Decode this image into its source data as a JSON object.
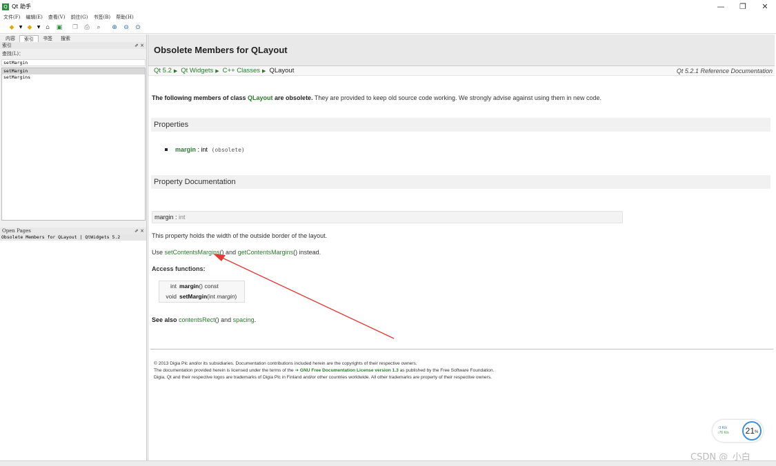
{
  "window": {
    "title": "Qt 助手",
    "icon": "qt-assistant-icon",
    "controls": [
      "—",
      "❐",
      "✕"
    ]
  },
  "menu": [
    "文件(F)",
    "编辑(E)",
    "查看(V)",
    "前往(G)",
    "书签(B)",
    "帮助(H)"
  ],
  "left_panel": {
    "tabs": [
      "内容",
      "索引",
      "书签",
      "搜索"
    ],
    "active_tab": "索引",
    "index_dock_title": "索引",
    "find_label": "查找(L)：",
    "search_value": "setMargin",
    "results": [
      "setMargin",
      "setMargins"
    ],
    "open_pages_title": "Open Pages",
    "open_pages": [
      "Obsolete Members for QLayout | QtWidgets 5.2"
    ]
  },
  "page": {
    "title": "Obsolete Members for QLayout",
    "breadcrumbs": [
      "Qt 5.2",
      "Qt Widgets",
      "C++ Classes"
    ],
    "breadcrumb_current": "QLayout",
    "ref_doc": "Qt 5.2.1 Reference Documentation",
    "intro": {
      "p1": "The following members of class ",
      "class_link": "QLayout",
      "p2": " are obsolete.",
      "p3": " They are provided to keep old source code working. We strongly advise against using them in new code."
    },
    "properties_heading": "Properties",
    "property_item": {
      "name": "margin",
      "type": " : int ",
      "note": "(obsolete)"
    },
    "property_doc_heading": "Property Documentation",
    "prop_box": {
      "name": "margin",
      "sep": " : ",
      "type": "int"
    },
    "prop_desc": "This property holds the width of the outside border of the layout.",
    "use_line": {
      "prefix": "Use ",
      "link1": "setContentsMargins",
      "mid": "() and ",
      "link2": "getContentsMargins",
      "suffix": "() instead."
    },
    "access_heading": "Access functions:",
    "access_functions": [
      {
        "ret": "int",
        "name": "margin",
        "args": "() const"
      },
      {
        "ret": "void",
        "name": "setMargin",
        "args_pre": "(int ",
        "args_it": "margin",
        "args_post": ")"
      }
    ],
    "see_also": {
      "label": "See also",
      "link1": "contentsRect",
      "mid": "() and ",
      "link2": "spacing",
      "end": "."
    },
    "footer": {
      "line1": "© 2013 Digia Plc and/or its subsidiaries. Documentation contributions included herein are the copyrights of their respective owners.",
      "line2_pre": "The documentation provided herein is licensed under the terms of the ",
      "line2_link": "GNU Free Documentation License version 1.3",
      "line2_post": " as published by the Free Software Foundation.",
      "line3": "Digia, Qt and their respective logos are trademarks of Digia Plc in Finland and/or other countries worldwide. All other trademarks are property of their respective owners."
    }
  },
  "net_widget": {
    "up": "↑3 K/s",
    "down": "↓76 K/s",
    "value": "21",
    "unit": "%"
  },
  "watermark": "CSDN @_小白__",
  "colors": {
    "link": "#2a7a2e",
    "annotation_arrow": "#e53935"
  }
}
